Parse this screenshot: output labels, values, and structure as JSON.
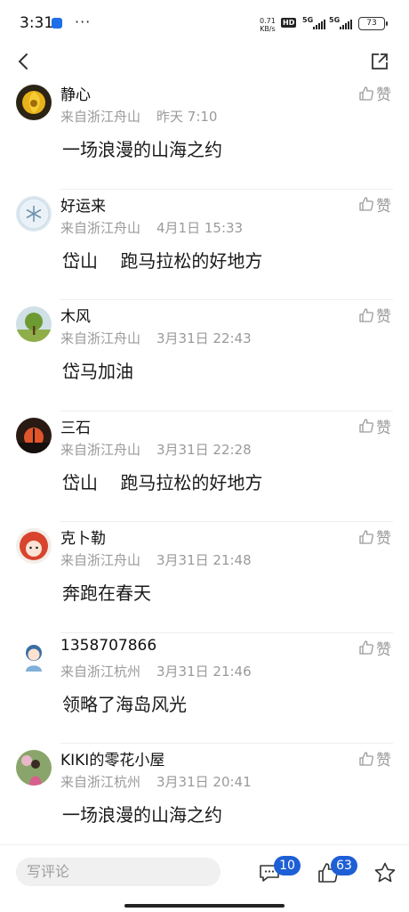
{
  "status_bar": {
    "time": "3:31",
    "more": "···",
    "net_speed_value": "0.71",
    "net_speed_unit": "KB/s",
    "hd": "HD",
    "signal_1": "5G",
    "signal_2": "5G",
    "battery": "73"
  },
  "comments": [
    {
      "name": "静心",
      "location": "来自浙江舟山",
      "time": "昨天  7:10",
      "content": "一场浪漫的山海之约",
      "like_label": "赞"
    },
    {
      "name": "好运来",
      "location": "来自浙江舟山",
      "time": "4月1日  15:33",
      "content": "岱山    跑马拉松的好地方",
      "like_label": "赞"
    },
    {
      "name": "木风",
      "location": "来自浙江舟山",
      "time": "3月31日  22:43",
      "content": "岱马加油",
      "like_label": "赞"
    },
    {
      "name": "三石",
      "location": "来自浙江舟山",
      "time": "3月31日  22:28",
      "content": "岱山    跑马拉松的好地方",
      "like_label": "赞"
    },
    {
      "name": "克卜勒",
      "location": "来自浙江舟山",
      "time": "3月31日  21:48",
      "content": "奔跑在春天",
      "like_label": "赞"
    },
    {
      "name": "1358707866",
      "location": "来自浙江杭州",
      "time": "3月31日  21:46",
      "content": "领略了海岛风光",
      "like_label": "赞"
    },
    {
      "name": "KIKI的零花小屋",
      "location": "来自浙江杭州",
      "time": "3月31日  20:41",
      "content": "一场浪漫的山海之约",
      "like_label": "赞"
    }
  ],
  "bottom_bar": {
    "placeholder": "写评论",
    "comment_count": "10",
    "like_count": "63"
  },
  "colors": {
    "badge": "#1e5fd6",
    "meta_text": "#9a9a9a",
    "input_bg": "#f0f0f0"
  }
}
